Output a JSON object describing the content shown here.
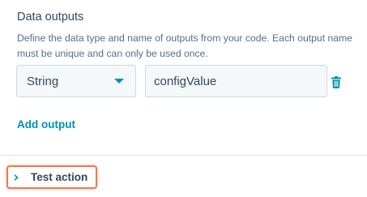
{
  "data_outputs": {
    "title": "Data outputs",
    "description": "Define the data type and name of outputs from your code. Each output name must be unique and can only be used once.",
    "output_row": {
      "type_value": "String",
      "name_value": "configValue"
    },
    "add_output_label": "Add output"
  },
  "test_action": {
    "label": "Test action"
  },
  "icons": {
    "select_caret": "caret-down-icon",
    "delete": "trash-icon",
    "expand": "chevron-right-icon"
  },
  "colors": {
    "text": "#33475b",
    "link": "#0091ae",
    "highlight_border": "#ec7a50",
    "input_bg": "#f5f8fa",
    "input_border": "#cbd6e2"
  }
}
